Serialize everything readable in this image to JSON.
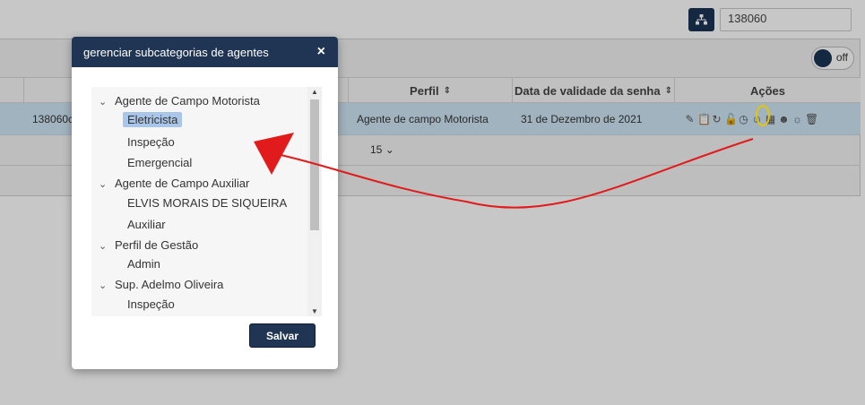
{
  "top": {
    "search_value": "138060",
    "tree_icon": "sitemap-icon"
  },
  "toolbar": {
    "toggle_label": "off"
  },
  "table": {
    "headers": {
      "perfil": "Perfil",
      "validade": "Data de validade da senha",
      "acoes": "Ações"
    },
    "row": {
      "id": "138060c",
      "perfil": "Agente de campo Motorista",
      "validade": "31 de Dezembro de 2021"
    },
    "action_icons": [
      "pencil-icon",
      "clipboard-icon",
      "refresh-icon",
      "unlock-icon",
      "clock-icon",
      "user-subcategory-icon",
      "qrcode-icon",
      "users-icon",
      "user-settings-icon",
      "trash-icon"
    ]
  },
  "pager": {
    "page_size": "15"
  },
  "modal": {
    "title": "gerenciar subcategorias de agentes",
    "close": "×",
    "tree": [
      {
        "label": "Agente de Campo Motorista",
        "children": [
          "Eletricista",
          "Inspeção",
          "Emergencial"
        ]
      },
      {
        "label": "Agente de Campo Auxiliar",
        "children": [
          "ELVIS MORAIS DE SIQUEIRA",
          "Auxiliar"
        ]
      },
      {
        "label": "Perfil de Gestão",
        "children": [
          "Admin"
        ]
      },
      {
        "label": "Sup. Adelmo Oliveira",
        "children": [
          "Inspeção"
        ]
      }
    ],
    "selected": "Eletricista",
    "save_label": "Salvar"
  },
  "colors": {
    "navy": "#1f3553",
    "selected_row": "#cfe6f5",
    "highlight": "#e7c400",
    "arrow": "#e11b1b"
  }
}
